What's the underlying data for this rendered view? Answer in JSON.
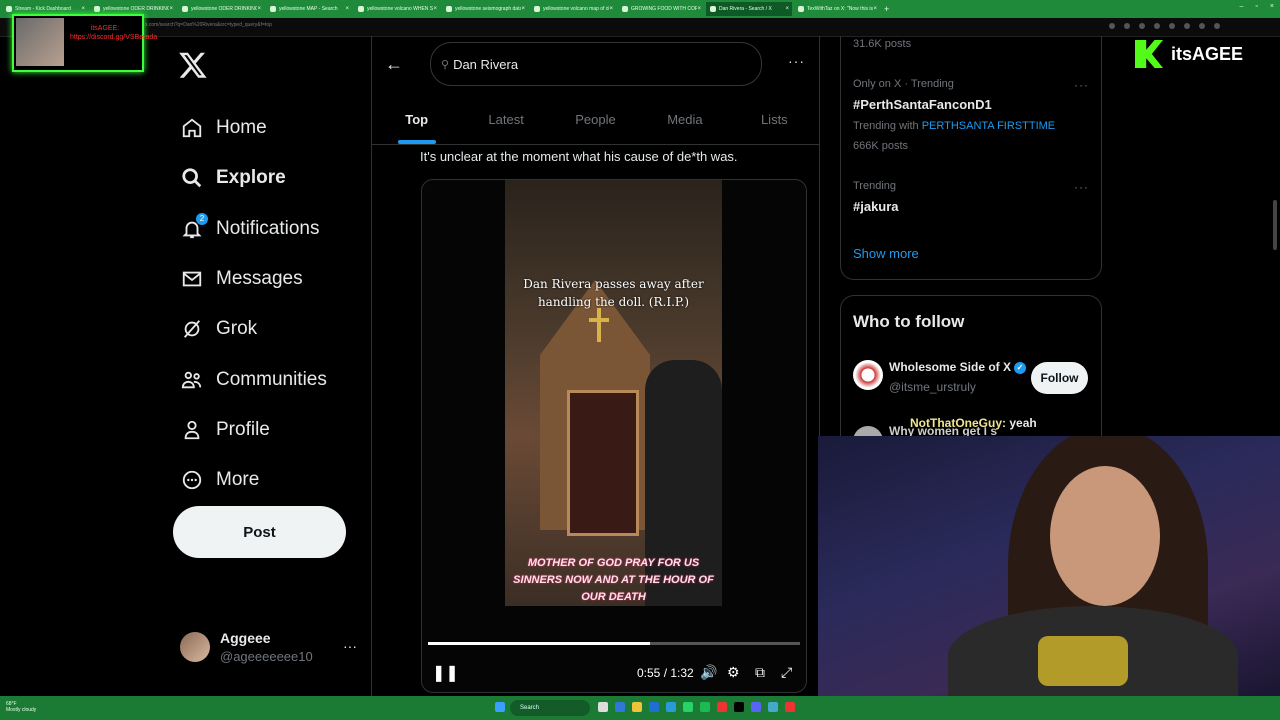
{
  "browser": {
    "tabs": [
      {
        "label": "Stream - Kick Dashboard",
        "active": false
      },
      {
        "label": "yellowstone ODER DRINKING TH",
        "active": false
      },
      {
        "label": "yellowstone ODER DRINKING TH",
        "active": false
      },
      {
        "label": "yellowstone MAP - Search",
        "active": false
      },
      {
        "label": "yellowstone volcano WHEN SOO",
        "active": false
      },
      {
        "label": "yellowstone seismograph data U",
        "active": false
      },
      {
        "label": "yellowstone volcano map of dem",
        "active": false
      },
      {
        "label": "GROWING FOOD WITH COFFEE",
        "active": false
      },
      {
        "label": "Dan Rivera - Search / X",
        "active": true
      },
      {
        "label": "TexWithTaz on X: \"Now this is ju",
        "active": false
      }
    ],
    "new_tab": "+",
    "url": "x.com/search?q=Dan%20Rivera&src=typed_query&f=top"
  },
  "nav": {
    "logo": "X",
    "items": [
      {
        "label": "Home",
        "icon": "home-icon"
      },
      {
        "label": "Explore",
        "icon": "search-icon",
        "bold": true
      },
      {
        "label": "Notifications",
        "icon": "bell-icon",
        "badge": "2"
      },
      {
        "label": "Messages",
        "icon": "mail-icon"
      },
      {
        "label": "Grok",
        "icon": "grok-icon"
      },
      {
        "label": "Communities",
        "icon": "people-icon"
      },
      {
        "label": "Profile",
        "icon": "person-icon"
      },
      {
        "label": "More",
        "icon": "more-circle-icon"
      }
    ],
    "post_label": "Post",
    "account": {
      "name": "Aggeee",
      "handle": "@ageeeeeee10",
      "more": "···"
    }
  },
  "main": {
    "back": "←",
    "search_value": "Dan Rivera",
    "more": "···",
    "tabs": [
      "Top",
      "Latest",
      "People",
      "Media",
      "Lists"
    ],
    "selected_tab": "Top",
    "tweet_text": "It's unclear at the moment what his cause of de*th was.",
    "video": {
      "caption": "Dan Rivera passes away after handling the doll. (R.I.P.)",
      "subtitle": "MOTHER OF GOD PRAY FOR US SINNERS NOW AND AT THE HOUR OF OUR DEATH",
      "time": "0:55 / 1:32",
      "progress": 0.598
    }
  },
  "right": {
    "trend0_posts": "31.6K posts",
    "trend1": {
      "context": "Only on X · Trending",
      "name": "#PerthSantaFanconD1",
      "with_label": "Trending with",
      "with_link": "PERTHSANTA FIRSTTIME",
      "posts": "666K posts"
    },
    "trend2": {
      "context": "Trending",
      "name": "#jakura"
    },
    "show_more": "Show more",
    "who_to_follow": "Who to follow",
    "suggestion": {
      "name": "Wholesome Side of X",
      "handle": "@itsme_urstruly",
      "follow": "Follow"
    },
    "suggestion2_name": "Why women get l s"
  },
  "overlay": {
    "brand": "itsAGEE",
    "pip_text": "itsAGEE: https://discord.gg/VSBerada",
    "chat_user": "NotThatOneGuy:",
    "chat_msg": "yeah"
  },
  "taskbar": {
    "weather_temp": "68°F",
    "weather_desc": "Mostly cloudy",
    "search": "Search"
  },
  "colors": {
    "accent": "#1d9bf0",
    "tab_green": "#1f8a3a",
    "kick_green": "#53fc18"
  }
}
